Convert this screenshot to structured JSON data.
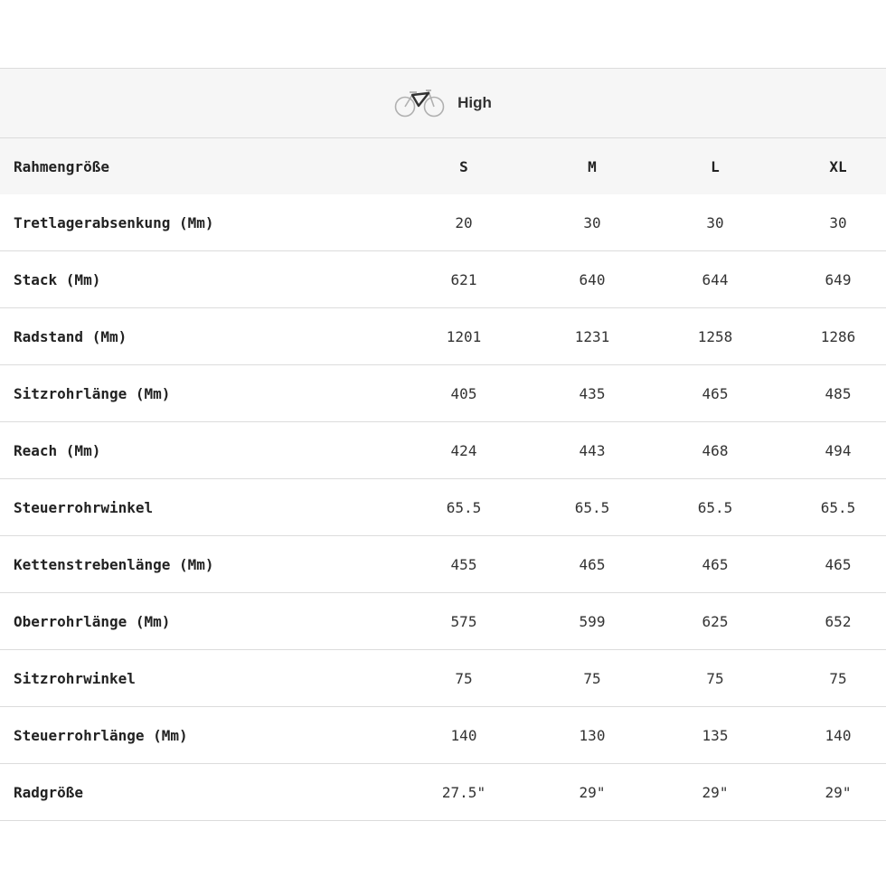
{
  "mode": {
    "label": "High",
    "icon": "bicycle-icon"
  },
  "table": {
    "header": {
      "label": "Rahmengröße",
      "sizes": [
        "S",
        "M",
        "L",
        "XL"
      ]
    },
    "rows": [
      {
        "label": "Tretlagerabsenkung (Mm)",
        "values": [
          "20",
          "30",
          "30",
          "30"
        ]
      },
      {
        "label": "Stack (Mm)",
        "values": [
          "621",
          "640",
          "644",
          "649"
        ]
      },
      {
        "label": "Radstand (Mm)",
        "values": [
          "1201",
          "1231",
          "1258",
          "1286"
        ]
      },
      {
        "label": "Sitzrohrlänge (Mm)",
        "values": [
          "405",
          "435",
          "465",
          "485"
        ]
      },
      {
        "label": "Reach (Mm)",
        "values": [
          "424",
          "443",
          "468",
          "494"
        ]
      },
      {
        "label": "Steuerrohrwinkel",
        "values": [
          "65.5",
          "65.5",
          "65.5",
          "65.5"
        ]
      },
      {
        "label": "Kettenstrebenlänge (Mm)",
        "values": [
          "455",
          "465",
          "465",
          "465"
        ]
      },
      {
        "label": "Oberrohrlänge (Mm)",
        "values": [
          "575",
          "599",
          "625",
          "652"
        ]
      },
      {
        "label": "Sitzrohrwinkel",
        "values": [
          "75",
          "75",
          "75",
          "75"
        ]
      },
      {
        "label": "Steuerrohrlänge (Mm)",
        "values": [
          "140",
          "130",
          "135",
          "140"
        ]
      },
      {
        "label": "Radgröße",
        "values": [
          "27.5\"",
          "29\"",
          "29\"",
          "29\""
        ]
      }
    ]
  }
}
